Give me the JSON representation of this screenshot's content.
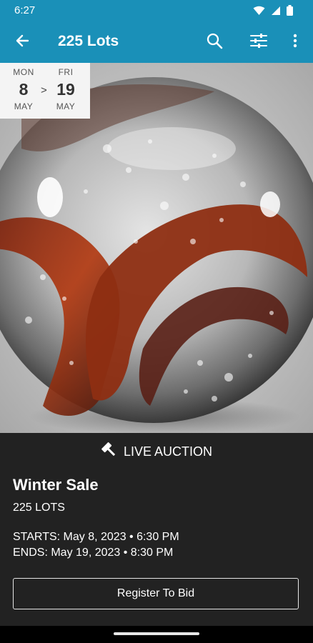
{
  "status_bar": {
    "time": "6:27",
    "icons": [
      "wifi-icon",
      "signal-icon",
      "battery-icon"
    ]
  },
  "app_bar": {
    "title": "225 Lots",
    "back_icon": "arrow-left-icon",
    "actions": [
      "search-icon",
      "filter-sliders-icon",
      "more-vert-icon"
    ],
    "color": "#1a90b8"
  },
  "date_badge": {
    "start": {
      "dow": "MON",
      "day": "8",
      "month": "MAY"
    },
    "separator": ">",
    "end": {
      "dow": "FRI",
      "day": "19",
      "month": "MAY"
    }
  },
  "hero": {
    "image": "glass marble photo",
    "icon": "marble-image"
  },
  "auction": {
    "type_label": "LIVE AUCTION",
    "type_icon": "gavel-icon",
    "title": "Winter Sale",
    "lots": "225 LOTS",
    "starts": "STARTS: May 8, 2023 • 6:30 PM",
    "ends": "ENDS: May 19, 2023 • 8:30 PM",
    "register_label": "Register To Bid"
  },
  "colors": {
    "panel_bg": "#222222",
    "text": "#ffffff"
  }
}
